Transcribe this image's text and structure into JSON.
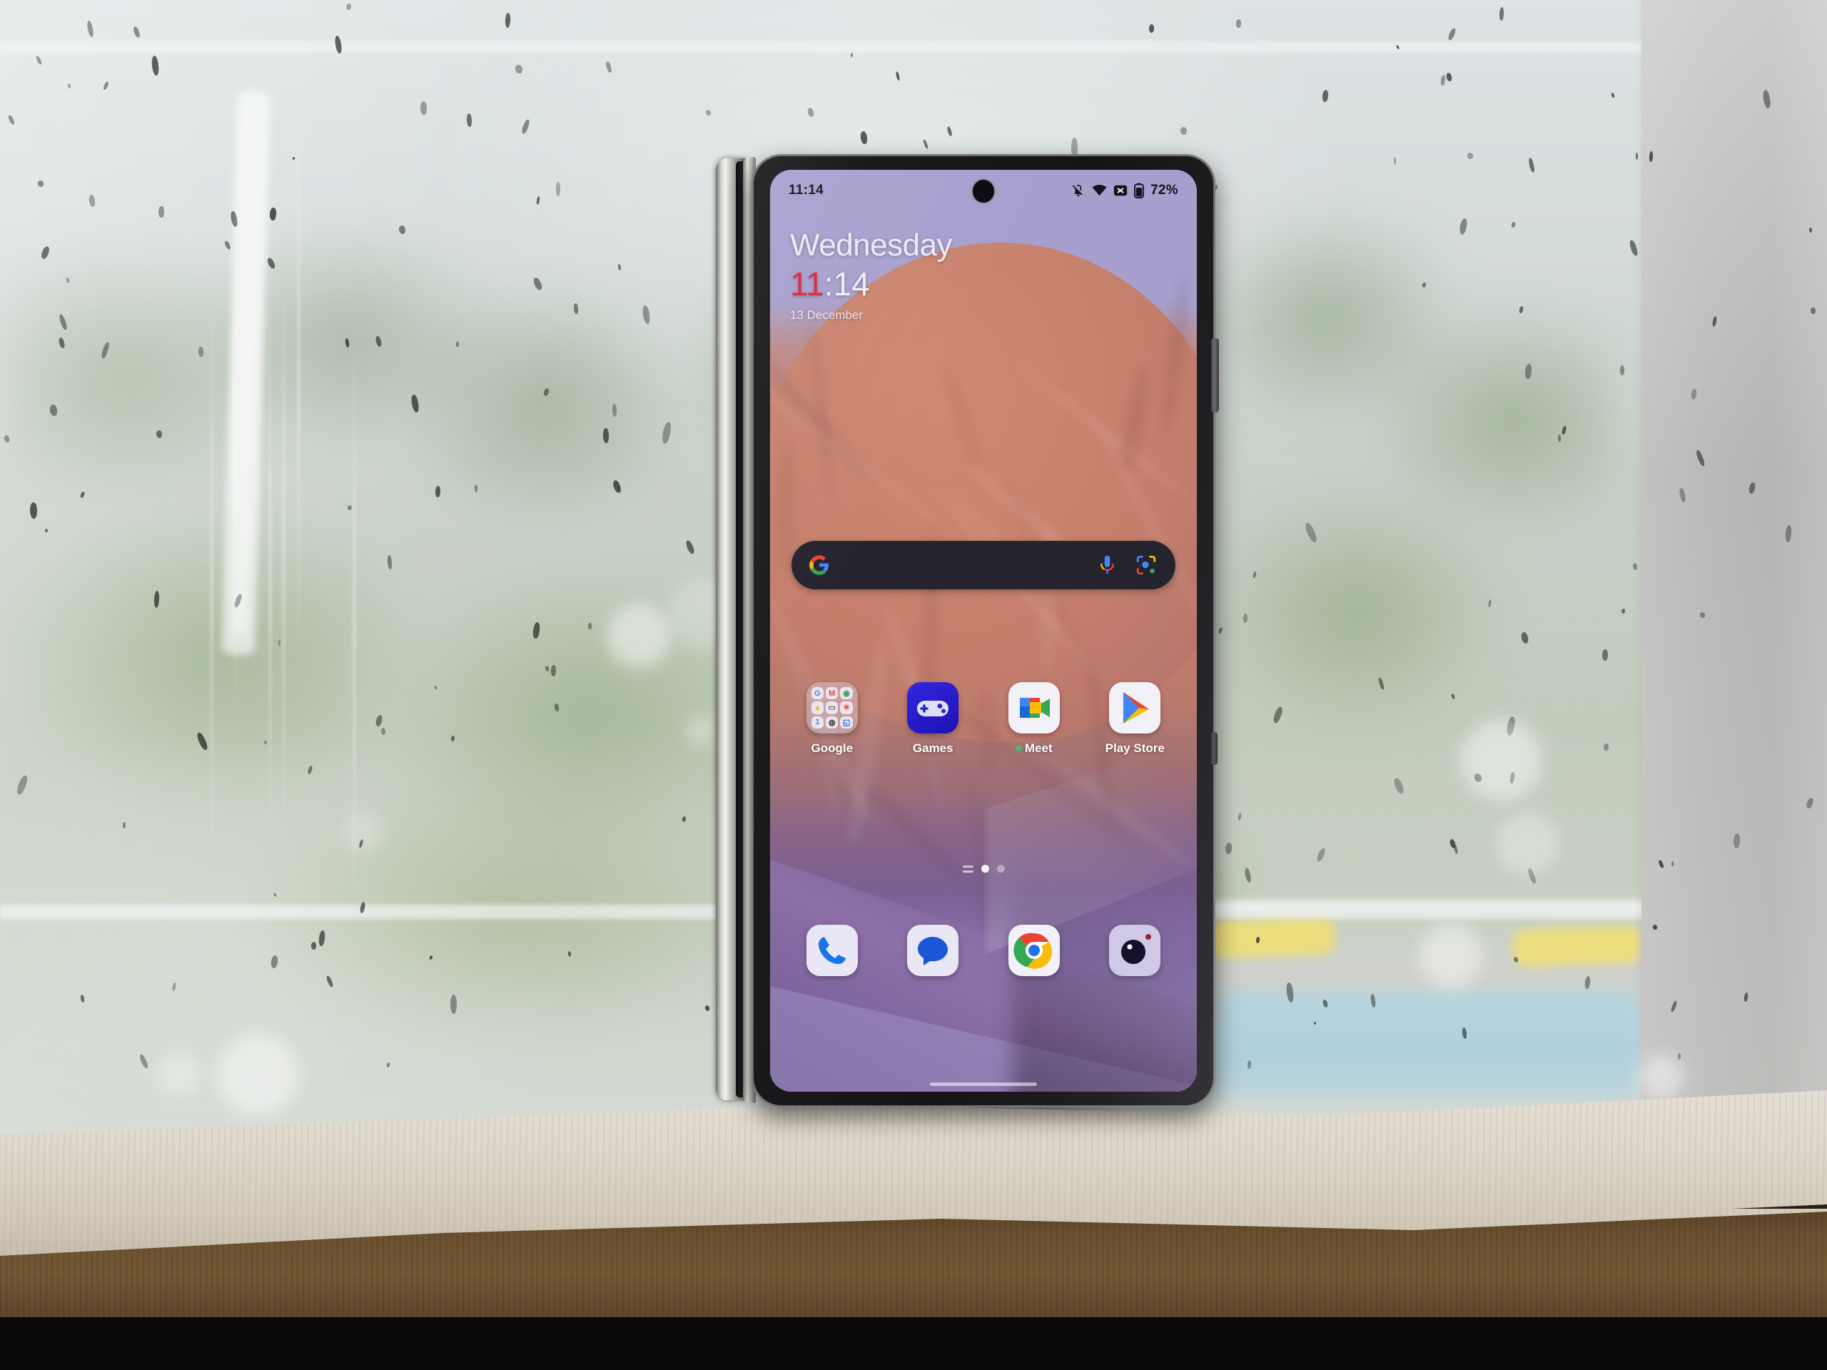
{
  "scene": {
    "description": "Smartphone standing on a wooden windowsill in front of a hazy window",
    "background": {
      "view": "blurred green trees and hazy sky seen through a dirty window",
      "pole_label": "white pole",
      "pool_label": "swimming pool",
      "lounger_label": "yellow lounger",
      "wall_label": "grey wall",
      "sill_label": "wooden windowsill"
    },
    "device": {
      "name": "foldable-phone",
      "hinge_label": "fold hinge",
      "side_button_label": "power button",
      "volume_button_label": "volume button",
      "punch_hole_label": "front camera"
    }
  },
  "status_bar": {
    "time": "11:14",
    "battery_percent": "72%",
    "icons": [
      "mute-icon",
      "wifi-icon",
      "no-sim-icon",
      "battery-icon"
    ]
  },
  "clock_widget": {
    "day": "Wednesday",
    "time_hours": "11",
    "time_minutes": ":14",
    "date": "13 December",
    "hours_color": "#d8283a"
  },
  "search_bar": {
    "placeholder": "",
    "icons": [
      "google-g-icon",
      "microphone-icon",
      "google-lens-icon"
    ],
    "background_color": "#25232e"
  },
  "home_screen": {
    "apps": [
      {
        "label": "Google",
        "type": "folder",
        "folder_items": [
          "G",
          "M",
          "⌖",
          "△",
          "▭",
          "✸",
          "1",
          "◉",
          "◰"
        ]
      },
      {
        "label": "Games",
        "type": "app",
        "icon": "gamepad-icon",
        "color": "#2a1fd4"
      },
      {
        "label": "Meet",
        "type": "app",
        "icon": "meet-icon",
        "badge": "notification-dot",
        "badge_color": "#39c16c"
      },
      {
        "label": "Play Store",
        "type": "app",
        "icon": "play-store-icon"
      }
    ],
    "page_indicator": {
      "pages": 2,
      "active_page": 1,
      "has_list_glyph": true
    }
  },
  "dock": {
    "apps": [
      {
        "label": "Phone",
        "icon": "phone-icon"
      },
      {
        "label": "Messages",
        "icon": "messages-icon"
      },
      {
        "label": "Chrome",
        "icon": "chrome-icon"
      },
      {
        "label": "Camera",
        "icon": "camera-icon"
      }
    ]
  },
  "wallpaper": {
    "description": "coral orange fabric folds fading into purple",
    "top_color": "#a7a0cf",
    "mid_color": "#c4837a",
    "bottom_color": "#7b639c"
  }
}
